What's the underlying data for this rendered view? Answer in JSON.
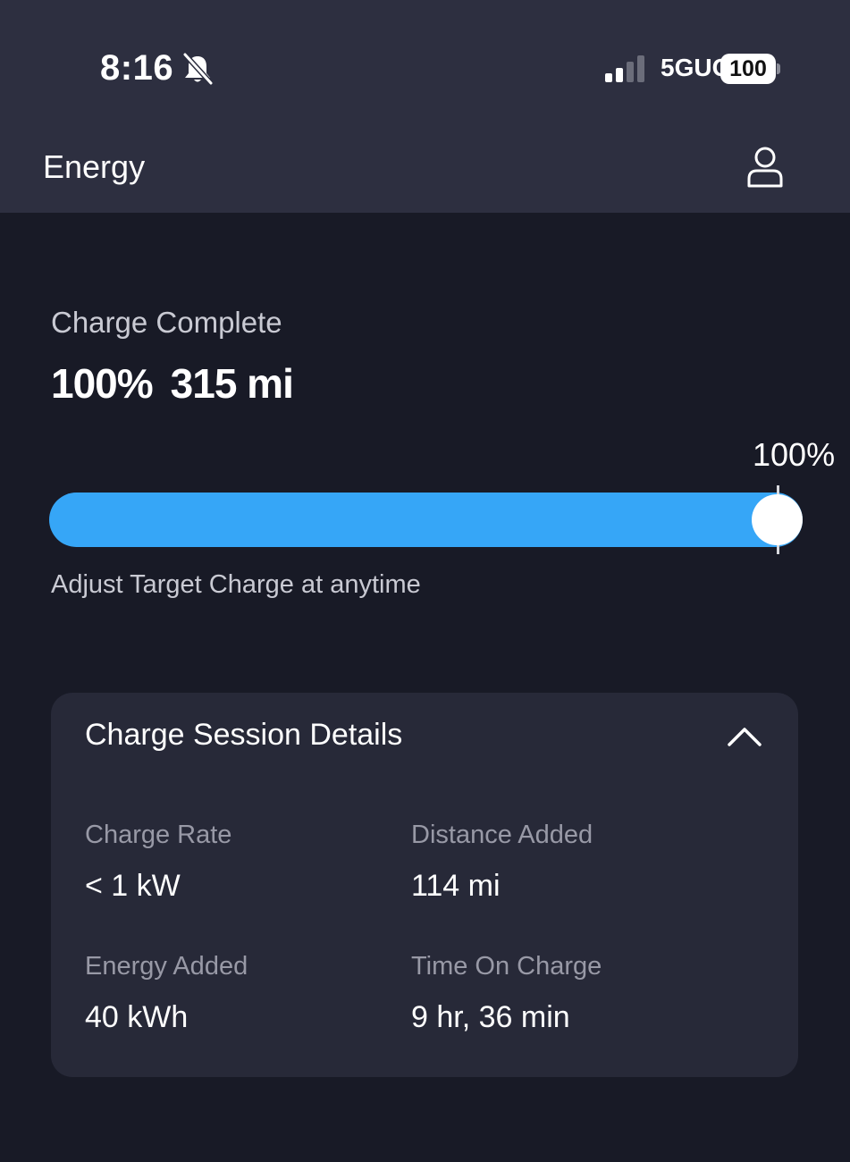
{
  "status_bar": {
    "time": "8:16",
    "network": "5GUC",
    "battery": "100"
  },
  "header": {
    "title": "Energy"
  },
  "charge": {
    "status": "Charge Complete",
    "percent": "100%",
    "range": "315 mi",
    "target_label": "100%",
    "target_fraction": 1.0,
    "hint": "Adjust Target Charge at anytime"
  },
  "session": {
    "title": "Charge Session Details",
    "stats": [
      {
        "label": "Charge Rate",
        "value": "< 1 kW"
      },
      {
        "label": "Distance Added",
        "value": "114 mi"
      },
      {
        "label": "Energy Added",
        "value": "40 kWh"
      },
      {
        "label": "Time On Charge",
        "value": "9 hr, 36 min"
      }
    ]
  },
  "colors": {
    "accent": "#36a6f7",
    "header_bg": "#2d2f40",
    "page_bg": "#181a26",
    "card_bg": "#272938"
  },
  "icons": {
    "silent": "bell-slash-icon",
    "signal": "cell-signal-icon",
    "profile": "person-icon",
    "collapse": "chevron-up-icon"
  }
}
